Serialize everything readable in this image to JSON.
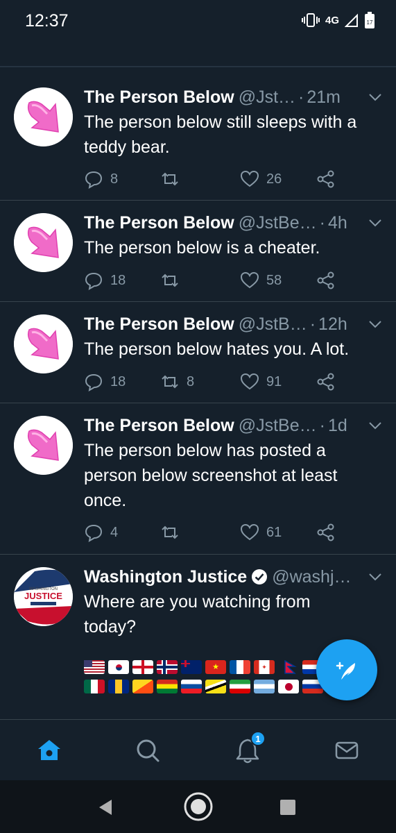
{
  "status_bar": {
    "time": "12:37",
    "network": "4G",
    "battery": "17"
  },
  "tweets": [
    {
      "author": "The Person Below",
      "handle": "@Jst…",
      "time": "21m",
      "text": [
        "The person below still sleeps with a",
        "teddy bear."
      ],
      "replies": "8",
      "retweets": "",
      "likes": "26"
    },
    {
      "author": "The Person Below",
      "handle": "@JstBe…",
      "time": "4h",
      "text": [
        "The person below is a cheater."
      ],
      "replies": "18",
      "retweets": "",
      "likes": "58"
    },
    {
      "author": "The Person Below",
      "handle": "@JstB…",
      "time": "12h",
      "text": [
        "The person below hates you. A lot."
      ],
      "replies": "18",
      "retweets": "8",
      "likes": "91"
    },
    {
      "author": "The Person Below",
      "handle": "@JstBe…",
      "time": "1d",
      "text": [
        "The person below has posted a",
        "person below screenshot at least",
        "once."
      ],
      "replies": "4",
      "retweets": "",
      "likes": "61"
    },
    {
      "author": "Washington Justice",
      "handle": "@washj…",
      "verified": true,
      "text": [
        "Where are you watching from",
        "today?"
      ],
      "avatar_text_top": "WASHINGTON",
      "avatar_text_main": "JUSTICE"
    }
  ],
  "flags": [
    [
      "us",
      "kr",
      "england",
      "no",
      "au",
      "vn",
      "fr",
      "ca",
      "np",
      "py"
    ],
    [
      "mx",
      "bb",
      "bt",
      "bo",
      "sk",
      "bn",
      "ir",
      "ar",
      "jp",
      "ru"
    ]
  ],
  "nav": {
    "notifications_badge": "1"
  },
  "colors": {
    "background": "#15202b",
    "accent": "#1da1f2",
    "secondary_text": "#8899a6",
    "divider": "#38444d"
  }
}
